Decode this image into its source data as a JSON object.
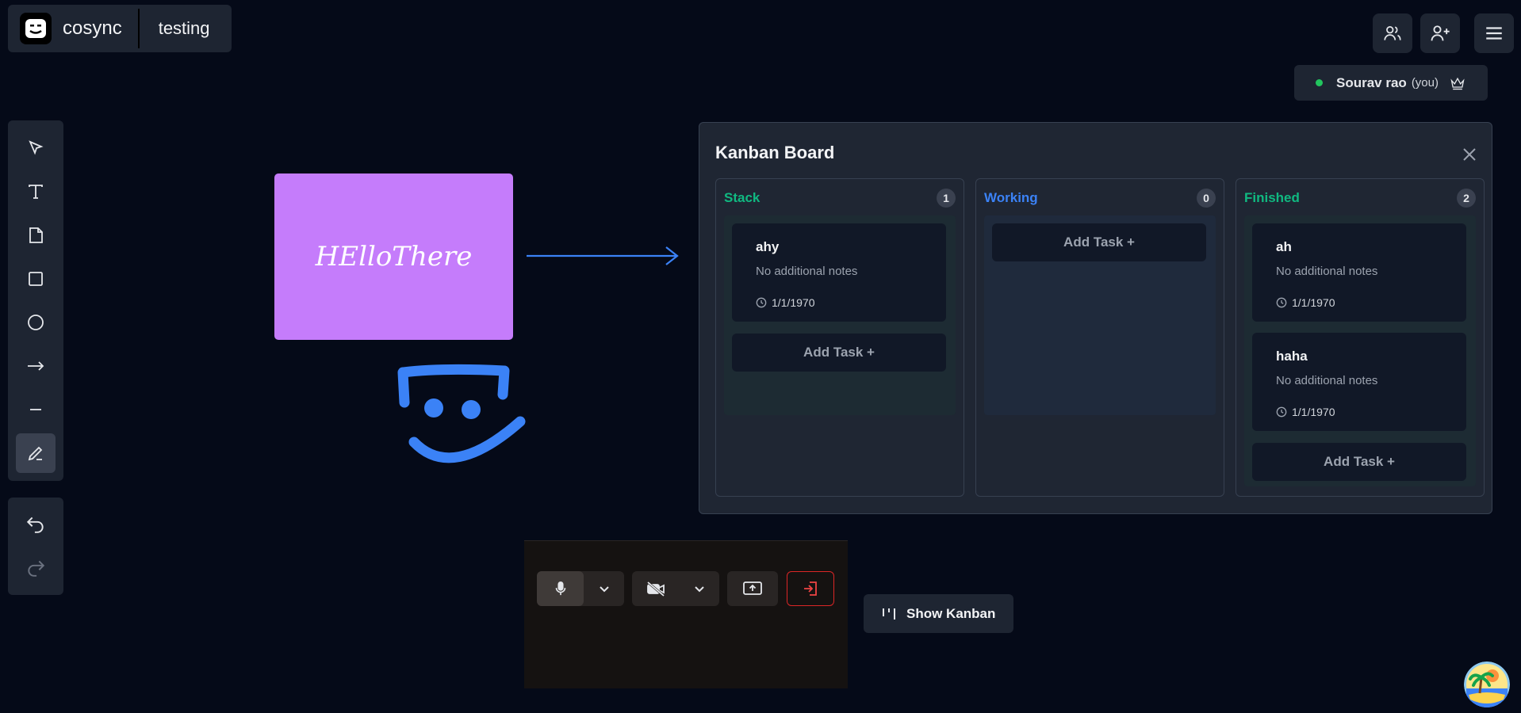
{
  "brand": {
    "name": "cosync",
    "room": "testing"
  },
  "user": {
    "name": "Sourav rao",
    "you_tag": "(you)",
    "status_color": "#22c55e"
  },
  "canvas": {
    "sticky_text": "HElloThere",
    "sticky_color": "#c57cfb",
    "stroke_color": "#3b82f6"
  },
  "kanban": {
    "title": "Kanban Board",
    "columns": [
      {
        "name": "Stack",
        "count": "1",
        "color": "#10b981",
        "cards": [
          {
            "title": "ahy",
            "notes": "No additional notes",
            "date": "1/1/1970"
          }
        ],
        "add_label": "Add Task +"
      },
      {
        "name": "Working",
        "count": "0",
        "color": "#3b82f6",
        "cards": [],
        "add_label": "Add Task +"
      },
      {
        "name": "Finished",
        "count": "2",
        "color": "#10b981",
        "cards": [
          {
            "title": "ah",
            "notes": "No additional notes",
            "date": "1/1/1970"
          },
          {
            "title": "haha",
            "notes": "No additional notes",
            "date": "1/1/1970"
          }
        ],
        "add_label": "Add Task +"
      }
    ]
  },
  "show_kanban_label": "Show Kanban",
  "tools": [
    "pointer-icon",
    "text-icon",
    "sticky-note-icon",
    "rectangle-icon",
    "ellipse-icon",
    "arrow-icon",
    "line-icon",
    "pen-icon"
  ],
  "history_tools": [
    "undo-icon",
    "redo-icon"
  ]
}
